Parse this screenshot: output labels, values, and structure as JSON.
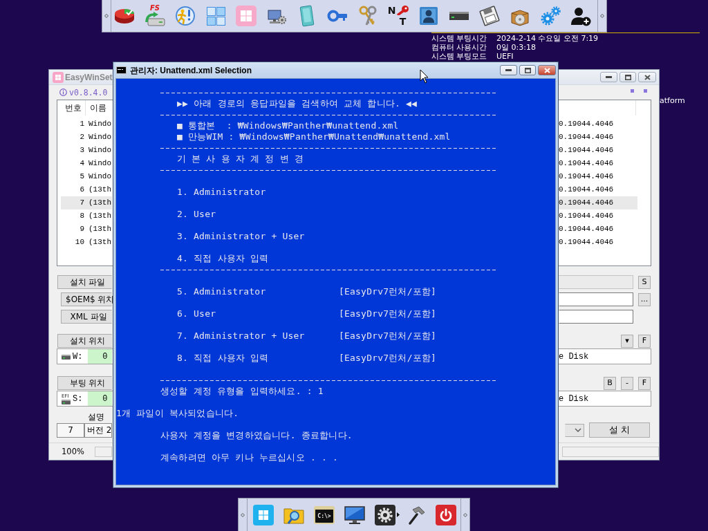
{
  "top_toolbar": {
    "drive_tool_label": "FS",
    "key_tool_letters": [
      "N",
      "T"
    ]
  },
  "system_info": [
    {
      "label": "시스템 부팅시간",
      "value": "2024-2-14 수요일 오전 7:19"
    },
    {
      "label": "컴퓨터 사용시간",
      "value": "0일 0:3:18"
    },
    {
      "label": "시스템 부팅모드",
      "value": "UEFI"
    }
  ],
  "desktop_text": "atform",
  "setup_window": {
    "title": "EasyWinSet",
    "version": "v0.8.4.0",
    "image_list": {
      "columns": [
        "번호",
        "이름"
      ],
      "rows": [
        {
          "number": "1",
          "name": "Windo",
          "version": "0.19044.4046",
          "selected": false
        },
        {
          "number": "2",
          "name": "Windo",
          "version": "0.19044.4046",
          "selected": false
        },
        {
          "number": "3",
          "name": "Windo",
          "version": "0.19044.4046",
          "selected": false
        },
        {
          "number": "4",
          "name": "Windo",
          "version": "0.19044.4046",
          "selected": false
        },
        {
          "number": "5",
          "name": "Windo",
          "version": "0.19044.4046",
          "selected": false
        },
        {
          "number": "6",
          "name": "(13th",
          "version": "0.19044.4046",
          "selected": false
        },
        {
          "number": "7",
          "name": "(13th",
          "version": "0.19044.4046",
          "selected": true
        },
        {
          "number": "8",
          "name": "(13th",
          "version": "0.19044.4046",
          "selected": false
        },
        {
          "number": "9",
          "name": "(13th",
          "version": "0.19044.4046",
          "selected": false
        },
        {
          "number": "10",
          "name": "(13th",
          "version": "0.19044.4046",
          "selected": false
        }
      ]
    },
    "file_rows": [
      {
        "button": "설치 파일",
        "field_disabled": true,
        "side_button": "S"
      },
      {
        "button": "$OEM$ 위치",
        "field_disabled": false,
        "side_button": "..."
      },
      {
        "button": "XML 파일",
        "field_disabled": false
      }
    ],
    "drives": [
      {
        "button": "설치 위치",
        "tool_buttons": [
          "▾",
          "F"
        ],
        "letter": "W:",
        "value": "0",
        "disk": "e Disk"
      },
      {
        "button": "부팅 위치",
        "tool_buttons": [
          "B",
          "-",
          "F"
        ],
        "icon_label": "EFI",
        "letter": "S:",
        "value": "0",
        "disk": "e Disk"
      }
    ],
    "description_label": "설명",
    "edition_index": "7",
    "edition_name": "버전 2",
    "install_button": "설 치",
    "status_zoom": "100%"
  },
  "console_window": {
    "title": "관리자: Unattend.xml Selection",
    "lines": [
      {
        "kind": "rule"
      },
      {
        "kind": "heading",
        "text": "▶▶ 아래 경로의 응답파일을 검색하여 교체 합니다. ◀◀"
      },
      {
        "kind": "rule"
      },
      {
        "kind": "path",
        "text": "■ 통합본  : ₩Windows₩Panther₩unattend.xml"
      },
      {
        "kind": "path",
        "text": "■ 만능WIM : ₩Windows₩Panther₩Unattend₩unattend.xml"
      },
      {
        "kind": "rule"
      },
      {
        "kind": "heading",
        "text": "기 본 사 용 자 계 정 변 경"
      },
      {
        "kind": "rule"
      },
      {
        "kind": "blank"
      },
      {
        "kind": "option",
        "text": "1. Administrator"
      },
      {
        "kind": "blank"
      },
      {
        "kind": "option",
        "text": "2. User"
      },
      {
        "kind": "blank"
      },
      {
        "kind": "option",
        "text": "3. Administrator + User"
      },
      {
        "kind": "blank"
      },
      {
        "kind": "option",
        "text": "4. 직접 사용자 입력"
      },
      {
        "kind": "rule"
      },
      {
        "kind": "blank"
      },
      {
        "kind": "option",
        "text": "5. Administrator",
        "tag": "[EasyDrv7런처/포함]"
      },
      {
        "kind": "blank"
      },
      {
        "kind": "option",
        "text": "6. User",
        "tag": "[EasyDrv7런처/포함]"
      },
      {
        "kind": "blank"
      },
      {
        "kind": "option",
        "text": "7. Administrator + User",
        "tag": "[EasyDrv7런처/포함]"
      },
      {
        "kind": "blank"
      },
      {
        "kind": "option",
        "text": "8. 직접 사용자 입력",
        "tag": "[EasyDrv7런처/포함]"
      },
      {
        "kind": "blank"
      },
      {
        "kind": "rule"
      },
      {
        "kind": "prompt",
        "text": "생성할 계정 유형을 입력하세요. : 1"
      },
      {
        "kind": "blank"
      },
      {
        "kind": "output",
        "text": "1개 파일이 복사되었습니다."
      },
      {
        "kind": "blank"
      },
      {
        "kind": "prompt",
        "text": "사용자 계정을 변경하였습니다. 종료합니다."
      },
      {
        "kind": "blank"
      },
      {
        "kind": "prompt",
        "text": "계속하려면 아무 키나 누르십시오 . . ."
      }
    ]
  },
  "bottom_taskbar": {
    "terminal_label": "C:\\>"
  }
}
